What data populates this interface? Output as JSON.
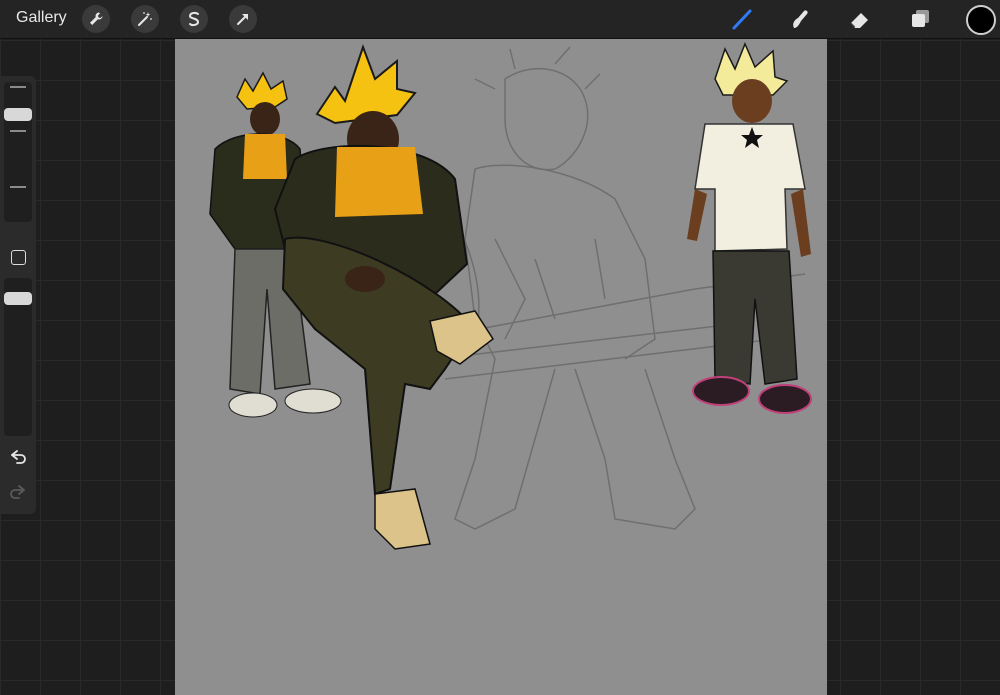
{
  "topbar": {
    "gallery_label": "Gallery",
    "left_tools": [
      "wrench-icon",
      "magic-wand-icon",
      "selection-icon",
      "transform-arrow-icon"
    ],
    "right_tools": [
      "brush-icon",
      "smudge-icon",
      "eraser-icon",
      "layers-icon"
    ],
    "active_tool_color": "#2f7bf5",
    "current_color": "#000000"
  },
  "sidebar": {
    "tools": [
      "brush-size-slider",
      "modify-button",
      "opacity-slider",
      "undo-icon",
      "redo-icon"
    ]
  },
  "canvas": {
    "background": "#8f8f8f",
    "content": "illustration-of-three-characters-with-sketch"
  }
}
